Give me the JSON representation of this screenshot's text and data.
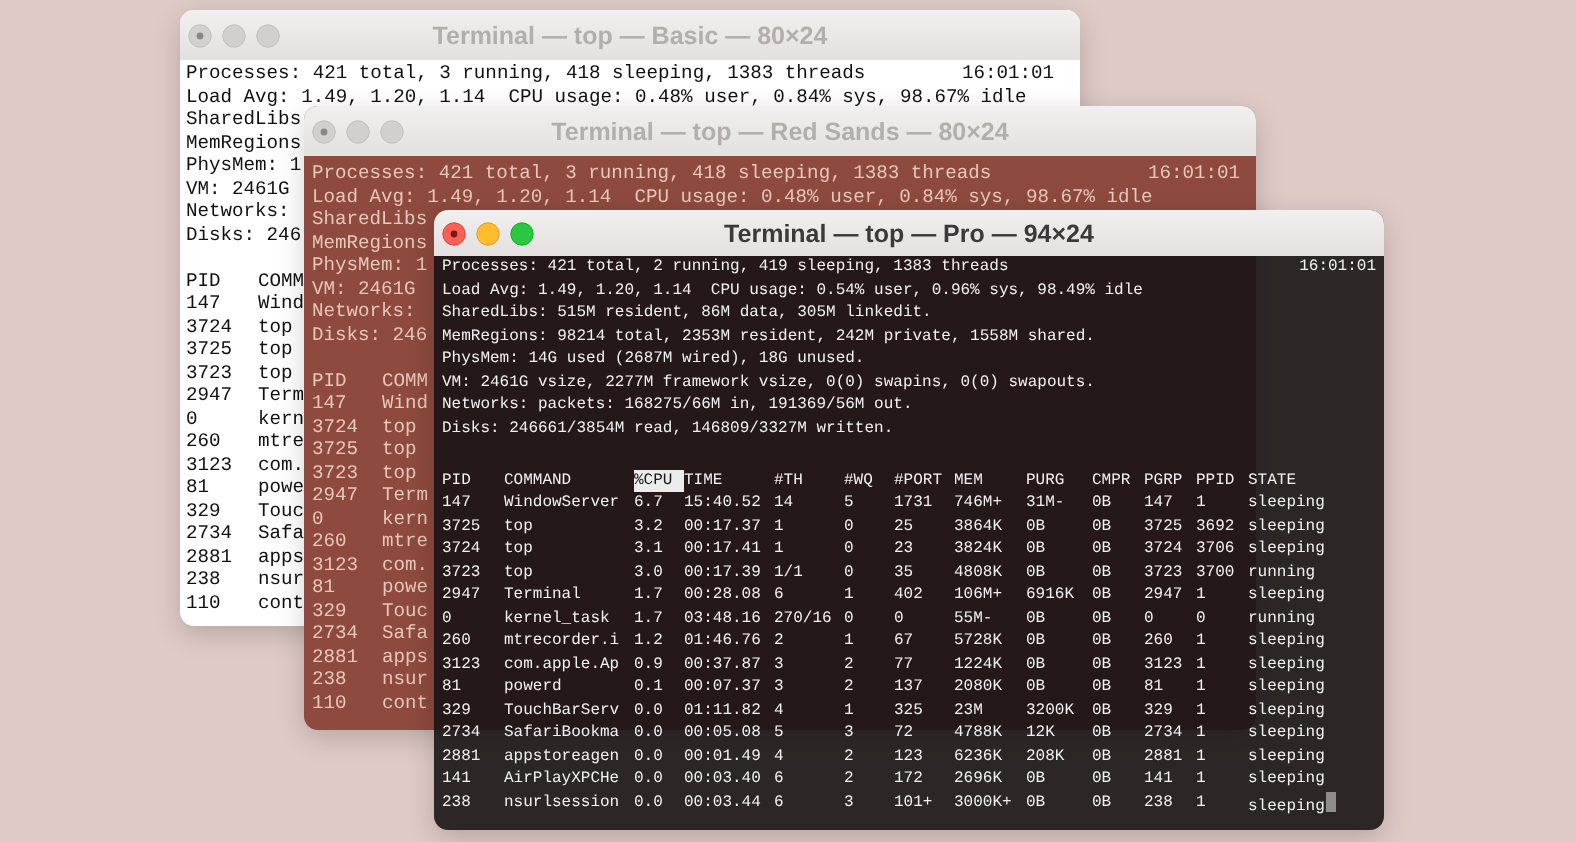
{
  "windows": [
    {
      "kind": "basic",
      "title": "Terminal — top — Basic — 80×24",
      "active": false,
      "clock": "16:01:01",
      "cursor": false,
      "lines": [
        "Processes: 421 total, 3 running, 418 sleeping, 1383 threads",
        "Load Avg: 1.49, 1.20, 1.14  CPU usage: 0.48% user, 0.84% sys, 98.67% idle",
        "SharedLibs",
        "MemRegions",
        "PhysMem: 1",
        "VM: 2461G",
        "Networks:",
        "Disks: 246"
      ],
      "columns": [
        {
          "label": "PID",
          "selected": false
        },
        {
          "label": "COMM",
          "selected": false
        }
      ],
      "rows": [
        [
          "147",
          "Wind"
        ],
        [
          "3724",
          "top"
        ],
        [
          "3725",
          "top"
        ],
        [
          "3723",
          "top"
        ],
        [
          "2947",
          "Term"
        ],
        [
          "0",
          "kern"
        ],
        [
          "260",
          "mtre"
        ],
        [
          "3123",
          "com."
        ],
        [
          "81",
          "powe"
        ],
        [
          "329",
          "Touc"
        ],
        [
          "2734",
          "Safa"
        ],
        [
          "2881",
          "apps"
        ],
        [
          "238",
          "nsur"
        ],
        [
          "110",
          "cont"
        ]
      ]
    },
    {
      "kind": "red-sands",
      "title": "Terminal — top — Red Sands — 80×24",
      "active": false,
      "clock": "16:01:01",
      "cursor": false,
      "lines": [
        "Processes: 421 total, 3 running, 418 sleeping, 1383 threads",
        "Load Avg: 1.49, 1.20, 1.14  CPU usage: 0.48% user, 0.84% sys, 98.67% idle",
        "SharedLibs",
        "MemRegions",
        "PhysMem: 1",
        "VM: 2461G",
        "Networks:",
        "Disks: 246"
      ],
      "columns": [
        {
          "label": "PID",
          "selected": false
        },
        {
          "label": "COMM",
          "selected": false
        }
      ],
      "rows": [
        [
          "147",
          "Wind"
        ],
        [
          "3724",
          "top"
        ],
        [
          "3725",
          "top"
        ],
        [
          "3723",
          "top"
        ],
        [
          "2947",
          "Term"
        ],
        [
          "0",
          "kern"
        ],
        [
          "260",
          "mtre"
        ],
        [
          "3123",
          "com."
        ],
        [
          "81",
          "powe"
        ],
        [
          "329",
          "Touc"
        ],
        [
          "2734",
          "Safa"
        ],
        [
          "2881",
          "apps"
        ],
        [
          "238",
          "nsur"
        ],
        [
          "110",
          "cont"
        ]
      ]
    },
    {
      "kind": "pro",
      "title": "Terminal — top — Pro — 94×24",
      "active": true,
      "clock": "16:01:01",
      "cursor": true,
      "lines": [
        "Processes: 421 total, 2 running, 419 sleeping, 1383 threads",
        "Load Avg: 1.49, 1.20, 1.14  CPU usage: 0.54% user, 0.96% sys, 98.49% idle",
        "SharedLibs: 515M resident, 86M data, 305M linkedit.",
        "MemRegions: 98214 total, 2353M resident, 242M private, 1558M shared.",
        "PhysMem: 14G used (2687M wired), 18G unused.",
        "VM: 2461G vsize, 2277M framework vsize, 0(0) swapins, 0(0) swapouts.",
        "Networks: packets: 168275/66M in, 191369/56M out.",
        "Disks: 246661/3854M read, 146809/3327M written."
      ],
      "columns": [
        {
          "label": "PID",
          "selected": false
        },
        {
          "label": "COMMAND",
          "selected": false
        },
        {
          "label": "%CPU",
          "selected": true
        },
        {
          "label": "TIME",
          "selected": false
        },
        {
          "label": "#TH",
          "selected": false
        },
        {
          "label": "#WQ",
          "selected": false
        },
        {
          "label": "#PORT",
          "selected": false
        },
        {
          "label": "MEM",
          "selected": false
        },
        {
          "label": "PURG",
          "selected": false
        },
        {
          "label": "CMPR",
          "selected": false
        },
        {
          "label": "PGRP",
          "selected": false
        },
        {
          "label": "PPID",
          "selected": false
        },
        {
          "label": "STATE",
          "selected": false
        }
      ],
      "rows": [
        [
          "147",
          "WindowServer",
          "6.7",
          "15:40.52",
          "14",
          "5",
          "1731",
          "746M+",
          "31M-",
          "0B",
          "147",
          "1",
          "sleeping"
        ],
        [
          "3725",
          "top",
          "3.2",
          "00:17.37",
          "1",
          "0",
          "25",
          "3864K",
          "0B",
          "0B",
          "3725",
          "3692",
          "sleeping"
        ],
        [
          "3724",
          "top",
          "3.1",
          "00:17.41",
          "1",
          "0",
          "23",
          "3824K",
          "0B",
          "0B",
          "3724",
          "3706",
          "sleeping"
        ],
        [
          "3723",
          "top",
          "3.0",
          "00:17.39",
          "1/1",
          "0",
          "35",
          "4808K",
          "0B",
          "0B",
          "3723",
          "3700",
          "running"
        ],
        [
          "2947",
          "Terminal",
          "1.7",
          "00:28.08",
          "6",
          "1",
          "402",
          "106M+",
          "6916K",
          "0B",
          "2947",
          "1",
          "sleeping"
        ],
        [
          "0",
          "kernel_task",
          "1.7",
          "03:48.16",
          "270/16",
          "0",
          "0",
          "55M-",
          "0B",
          "0B",
          "0",
          "0",
          "running"
        ],
        [
          "260",
          "mtrecorder.i",
          "1.2",
          "01:46.76",
          "2",
          "1",
          "67",
          "5728K",
          "0B",
          "0B",
          "260",
          "1",
          "sleeping"
        ],
        [
          "3123",
          "com.apple.Ap",
          "0.9",
          "00:37.87",
          "3",
          "2",
          "77",
          "1224K",
          "0B",
          "0B",
          "3123",
          "1",
          "sleeping"
        ],
        [
          "81",
          "powerd",
          "0.1",
          "00:07.37",
          "3",
          "2",
          "137",
          "2080K",
          "0B",
          "0B",
          "81",
          "1",
          "sleeping"
        ],
        [
          "329",
          "TouchBarServ",
          "0.0",
          "01:11.82",
          "4",
          "1",
          "325",
          "23M",
          "3200K",
          "0B",
          "329",
          "1",
          "sleeping"
        ],
        [
          "2734",
          "SafariBookma",
          "0.0",
          "00:05.08",
          "5",
          "3",
          "72",
          "4788K",
          "12K",
          "0B",
          "2734",
          "1",
          "sleeping"
        ],
        [
          "2881",
          "appstoreagen",
          "0.0",
          "00:01.49",
          "4",
          "2",
          "123",
          "6236K",
          "208K",
          "0B",
          "2881",
          "1",
          "sleeping"
        ],
        [
          "141",
          "AirPlayXPCHe",
          "0.0",
          "00:03.40",
          "6",
          "2",
          "172",
          "2696K",
          "0B",
          "0B",
          "141",
          "1",
          "sleeping"
        ],
        [
          "238",
          "nsurlsession",
          "0.0",
          "00:03.44",
          "6",
          "3",
          "101+",
          "3000K+",
          "0B",
          "0B",
          "238",
          "1",
          "sleeping"
        ]
      ]
    }
  ]
}
